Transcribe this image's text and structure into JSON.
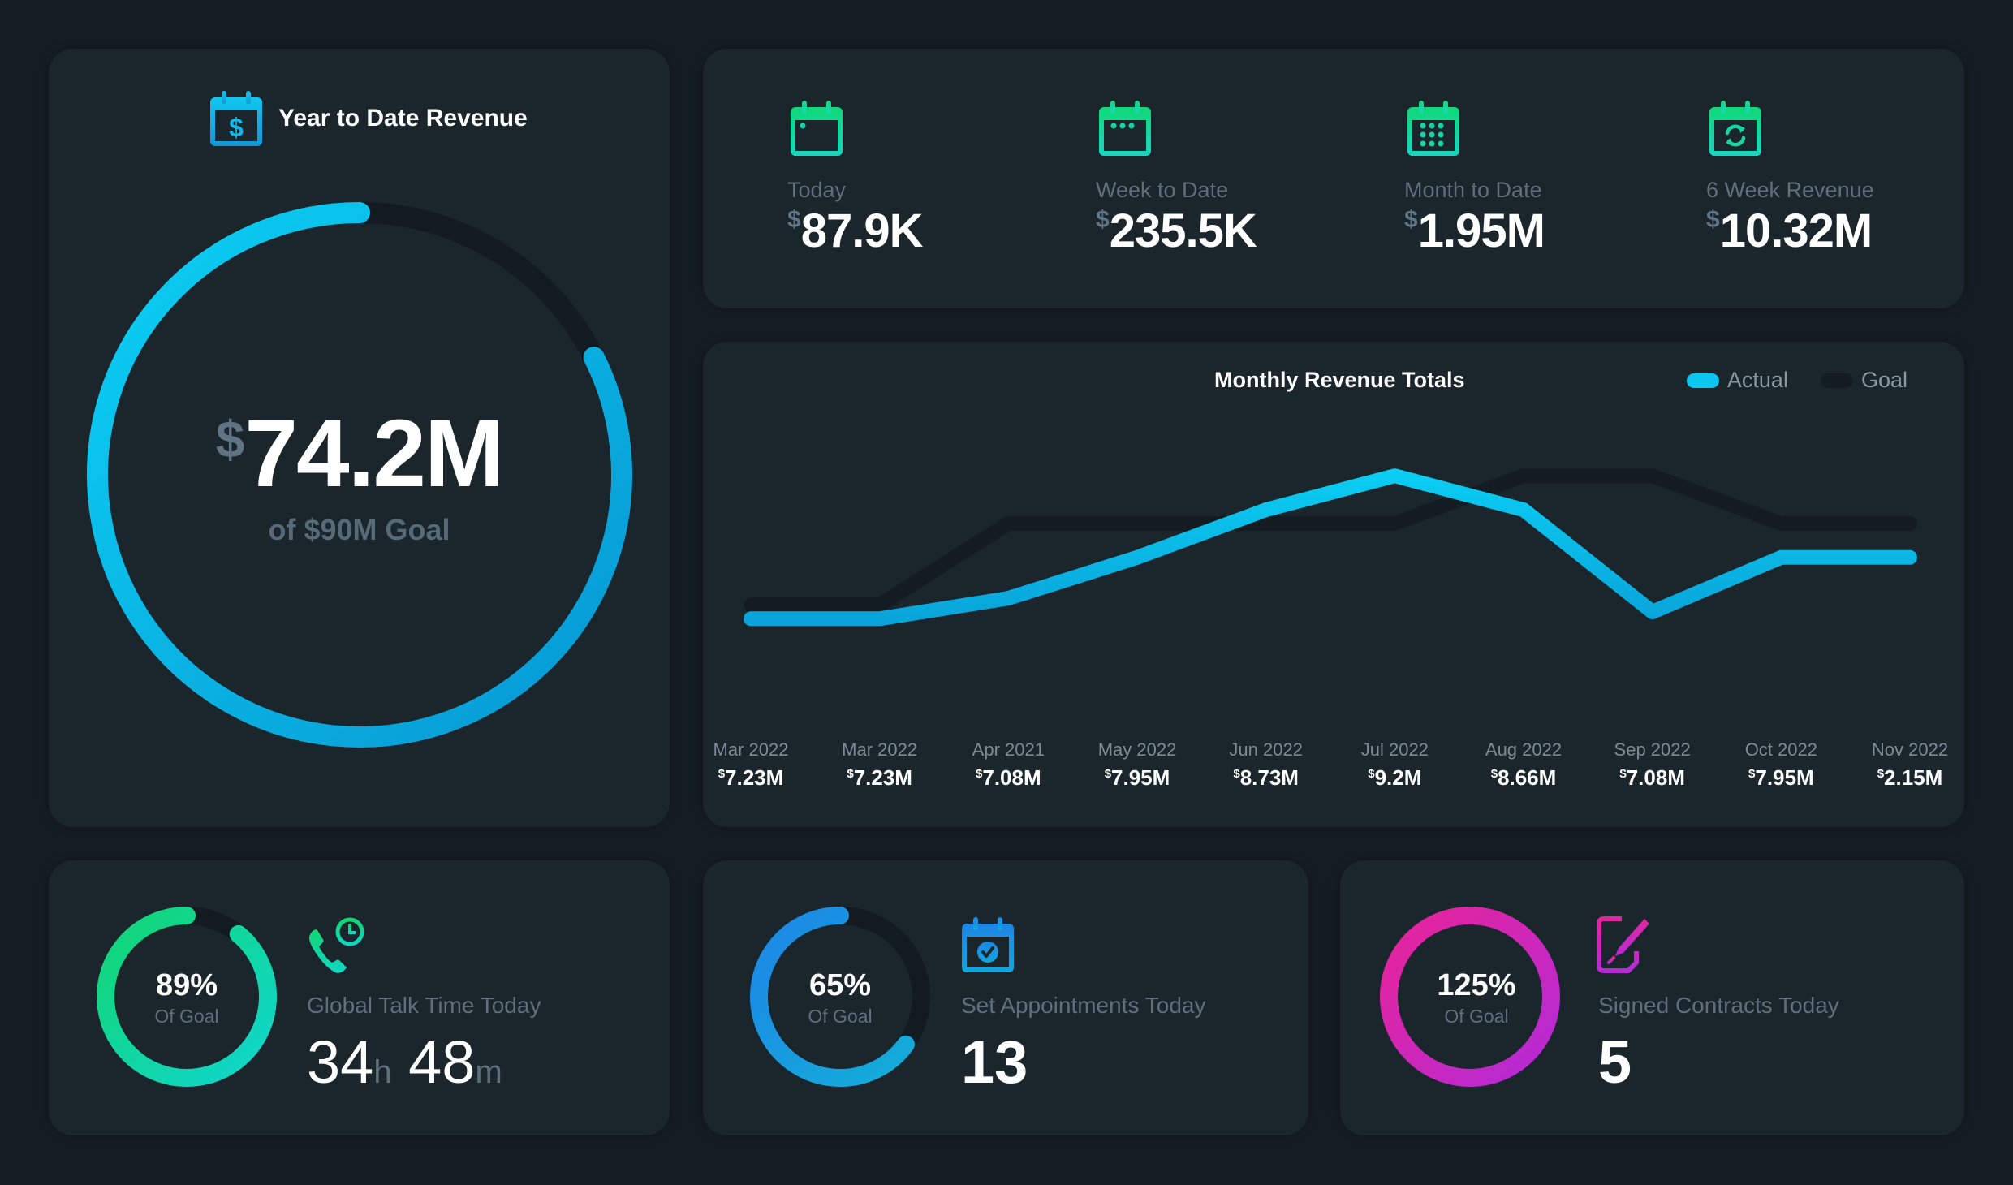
{
  "ytd": {
    "title": "Year to Date Revenue",
    "icon": "calendar-dollar-icon",
    "currency": "$",
    "value": "74.2M",
    "goal_text": "of $90M Goal",
    "progress_fraction": 0.824,
    "colors": {
      "start": "#0bd0f4",
      "end": "#0897d3",
      "track": "#121b21"
    }
  },
  "kpis": [
    {
      "icon": "calendar-today-icon",
      "label": "Today",
      "currency": "$",
      "value": "87.9K"
    },
    {
      "icon": "calendar-week-icon",
      "label": "Week to Date",
      "currency": "$",
      "value": "235.5K"
    },
    {
      "icon": "calendar-month-icon",
      "label": "Month to Date",
      "currency": "$",
      "value": "1.95M"
    },
    {
      "icon": "calendar-refresh-icon",
      "label": "6 Week Revenue",
      "currency": "$",
      "value": "10.32M"
    }
  ],
  "kpi_colors": {
    "icon_top": "#10d878",
    "icon_bottom": "#18d6c0"
  },
  "chart_data": {
    "type": "line",
    "title": "Monthly Revenue Totals",
    "xlabel": "",
    "ylabel": "",
    "grid": false,
    "legend": "top-right",
    "categories": [
      "Mar 2022",
      "Mar 2022",
      "Apr 2021",
      "May 2022",
      "Jun 2022",
      "Jul 2022",
      "Aug 2022",
      "Sep 2022",
      "Oct 2022",
      "Nov 2022"
    ],
    "value_labels": [
      "7.23M",
      "7.23M",
      "7.08M",
      "7.95M",
      "8.73M",
      "9.2M",
      "8.66M",
      "7.08M",
      "7.95M",
      "2.15M"
    ],
    "currency": "$",
    "series": [
      {
        "name": "Actual",
        "color": "#0bc7ef",
        "values": [
          7.0,
          7.0,
          7.3,
          7.9,
          8.6,
          9.1,
          8.6,
          7.1,
          7.9,
          7.9
        ]
      },
      {
        "name": "Goal",
        "color": "#131c22",
        "values": [
          7.2,
          7.2,
          8.4,
          8.4,
          8.4,
          8.4,
          9.1,
          9.1,
          8.4,
          8.4
        ]
      }
    ],
    "ylim": [
      6.3,
      9.4
    ]
  },
  "stats": [
    {
      "id": "talk",
      "icon": "phone-clock-icon",
      "label": "Global Talk Time Today",
      "hours": "34",
      "hours_unit": "h",
      "minutes": "48",
      "minutes_unit": "m",
      "percent": "89%",
      "percent_value": 89,
      "sub": "Of Goal",
      "colors": {
        "start": "#12d672",
        "end": "#10d6d0"
      }
    },
    {
      "id": "appointments",
      "icon": "calendar-check-icon",
      "label": "Set Appointments Today",
      "value": "13",
      "percent": "65%",
      "percent_value": 65,
      "sub": "Of Goal",
      "colors": {
        "start": "#1d86e6",
        "end": "#13aed8"
      }
    },
    {
      "id": "contracts",
      "icon": "contract-sign-icon",
      "label": "Signed Contracts Today",
      "value": "5",
      "percent": "125%",
      "percent_value": 125,
      "sub": "Of Goal",
      "colors": {
        "start": "#e8249a",
        "end": "#b32ad6"
      }
    }
  ]
}
